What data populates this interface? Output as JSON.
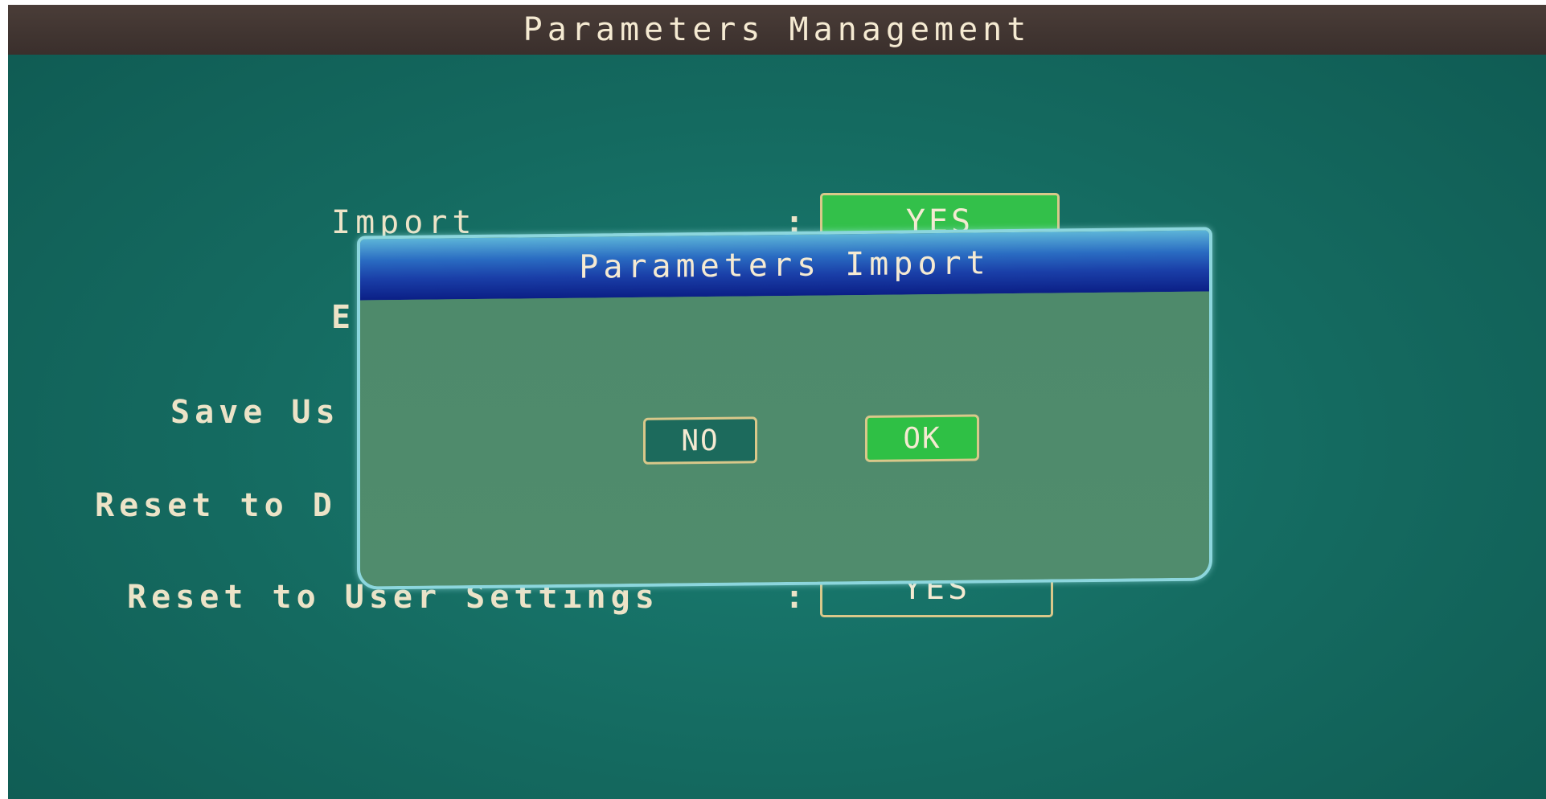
{
  "window": {
    "title": "Parameters Management"
  },
  "parameters": [
    {
      "label": "Import",
      "colon": ":",
      "value": "YES",
      "selected": true
    },
    {
      "label": "E",
      "colon": ":",
      "value": "",
      "selected": false
    },
    {
      "label": "Save Us",
      "colon": ":",
      "value": "",
      "selected": false
    },
    {
      "label": "Reset to D",
      "colon": ":",
      "value": "",
      "selected": false
    },
    {
      "label": "Reset to User Settings",
      "colon": ":",
      "value": "YES",
      "selected": false
    }
  ],
  "dialog": {
    "title": "Parameters Import",
    "buttons": {
      "no_label": "NO",
      "ok_label": "OK",
      "focused": "OK"
    }
  },
  "colors": {
    "background": "#14695f",
    "title_bar": "#3a2f2c",
    "selected_button": "#33c04a",
    "dialog_header": "#1a3fa8",
    "dialog_body": "#4f8a6c",
    "text": "#f5ead2"
  }
}
